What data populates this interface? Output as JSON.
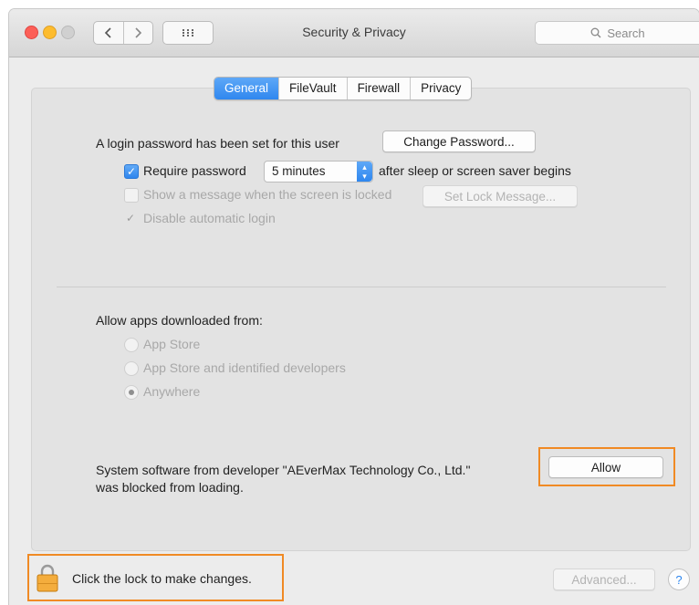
{
  "window": {
    "title": "Security & Privacy"
  },
  "toolbar": {
    "search_placeholder": "Search"
  },
  "tabs": [
    {
      "label": "General",
      "active": true
    },
    {
      "label": "FileVault",
      "active": false
    },
    {
      "label": "Firewall",
      "active": false
    },
    {
      "label": "Privacy",
      "active": false
    }
  ],
  "general": {
    "login_text": "A login password has been set for this user",
    "change_password_label": "Change Password...",
    "require_password_label": "Require password",
    "require_password_value": "5 minutes",
    "require_password_suffix": "after sleep or screen saver begins",
    "show_message_label": "Show a message when the screen is locked",
    "set_lock_message_label": "Set Lock Message...",
    "disable_auto_login_label": "Disable automatic login"
  },
  "allow_apps": {
    "heading": "Allow apps downloaded from:",
    "options": [
      {
        "label": "App Store",
        "selected": false
      },
      {
        "label": "App Store and identified developers",
        "selected": false
      },
      {
        "label": "Anywhere",
        "selected": true
      }
    ]
  },
  "blocked": {
    "line1": "System software from developer \"AEverMax Technology Co., Ltd.\"",
    "line2": "was blocked from loading.",
    "allow_label": "Allow"
  },
  "footer": {
    "lock_text": "Click the lock to make changes.",
    "advanced_label": "Advanced...",
    "help_label": "?"
  },
  "colors": {
    "accent": "#2f87ef",
    "highlight": "#f08a24"
  },
  "icons": [
    "close-light",
    "minimize-light",
    "zoom-light",
    "back-icon",
    "forward-icon",
    "grid-icon",
    "search-icon",
    "lock-icon",
    "help-icon"
  ]
}
